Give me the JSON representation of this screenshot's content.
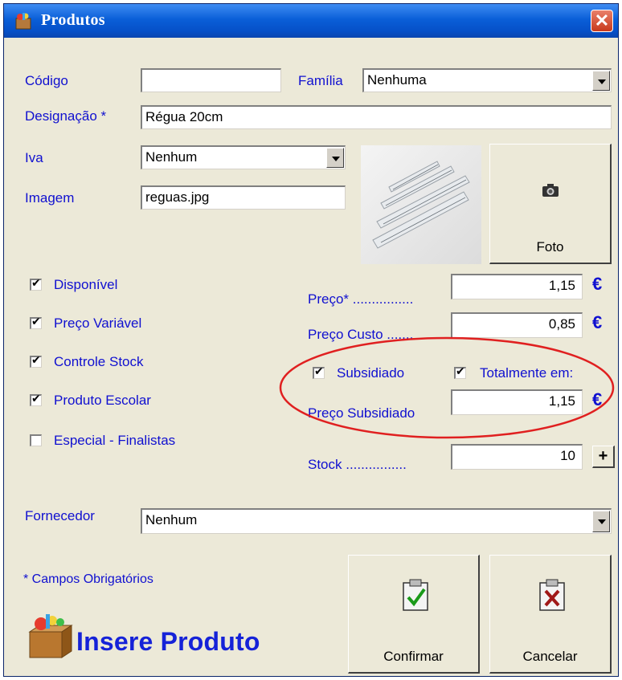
{
  "window": {
    "title": "Produtos",
    "close_label": "✕"
  },
  "form": {
    "codigo": {
      "label": "Código",
      "value": ""
    },
    "familia": {
      "label": "Família",
      "value": "Nenhuma"
    },
    "designacao": {
      "label": "Designação *",
      "value": "Régua 20cm"
    },
    "iva": {
      "label": "Iva",
      "value": "Nenhum"
    },
    "imagem": {
      "label": "Imagem",
      "value": "reguas.jpg"
    },
    "foto_button": "Foto",
    "preco": {
      "label": "Preço* ................",
      "value": "1,15",
      "currency": "€"
    },
    "preco_custo": {
      "label": "Preço Custo .......",
      "value": "0,85",
      "currency": "€"
    },
    "subsidiado": {
      "label": "Subsidiado",
      "checked": true
    },
    "totalmente": {
      "label": "Totalmente em:",
      "checked": true
    },
    "preco_subsidiado": {
      "label": "Preço Subsidiado",
      "value": "1,15",
      "currency": "€"
    },
    "stock": {
      "label": "Stock ................",
      "value": "10",
      "plus": "+"
    },
    "fornecedor": {
      "label": "Fornecedor",
      "value": "Nenhum"
    }
  },
  "checkboxes": [
    {
      "label": "Disponível",
      "checked": true
    },
    {
      "label": "Preço Variável",
      "checked": true
    },
    {
      "label": "Controle Stock",
      "checked": true
    },
    {
      "label": "Produto Escolar",
      "checked": true
    },
    {
      "label": "Especial - Finalistas",
      "checked": false
    }
  ],
  "footer": {
    "required_note": "* Campos Obrigatórios",
    "brand_text": "Insere Produto",
    "confirm_label": "Confirmar",
    "cancel_label": "Cancelar"
  },
  "colors": {
    "label_blue": "#1010d0",
    "highlight_ellipse": "#e02020",
    "titlebar": "#0a5fd8"
  }
}
